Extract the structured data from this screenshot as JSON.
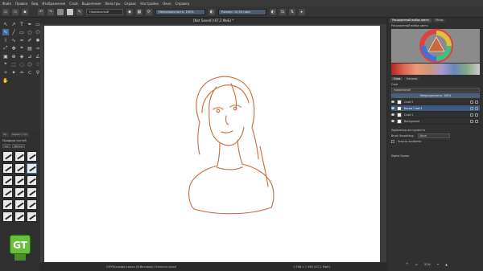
{
  "menu": [
    "Файл",
    "Правка",
    "Вид",
    "Изображение",
    "Слой",
    "Выделение",
    "Фильтры",
    "Сервис",
    "Настройки",
    "Окно",
    "Справка"
  ],
  "toolbar": {
    "blend_mode": "Нормальный",
    "opacity_label": "Непрозрачность: 100%",
    "size_label": "Размер: 10,00 пикс."
  },
  "document": {
    "tab_label": "[Not Saved] (67,2 МиБ) *"
  },
  "statusbar": {
    "left": "CMYK/альфа-канал (8-битовое) Chemical proof",
    "right": "1 508 x 1 480 (67,2 МиБ)",
    "zoom": "51%"
  },
  "brushes": {
    "tabs": [
      "Пр.",
      "Редакт. стр."
    ],
    "title": "Профили кистей",
    "filter_all": "All",
    "filter_tags": "Метки"
  },
  "docker": {
    "tabs_top": [
      "Расширенный выбор цвета",
      "Обзор"
    ],
    "selector_title": "Расширенный выбор цвета",
    "layers_tabs": [
      "Слои",
      "Каналы"
    ],
    "layers_title": "Слои",
    "layer_mode": "нормальный",
    "layer_opacity": "Непрозрачность: 100%",
    "layers": [
      {
        "name": "Слой 3",
        "active": false
      },
      {
        "name": "Копия Слой 1",
        "active": true
      },
      {
        "name": "Слой 1",
        "active": false
      },
      {
        "name": "Background",
        "active": false
      }
    ],
    "tool_options_title": "Параметры инструмента",
    "brush_smoothing_label": "Brush Smoothing:",
    "brush_smoothing_value": "None",
    "snap_label": "Snap to Assistants",
    "digital_docker": "Digital Docker"
  },
  "colors": {
    "accent": "#3f6ea6",
    "sketch": "#c86a3c",
    "canvas": "#ffffff"
  }
}
